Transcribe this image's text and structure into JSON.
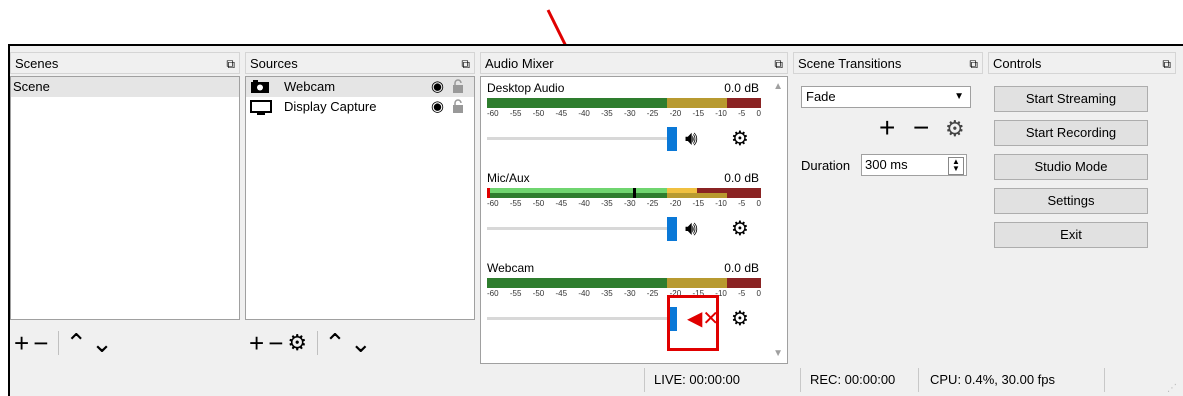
{
  "docks": {
    "scenes": {
      "title": "Scenes",
      "items": [
        "Scene"
      ]
    },
    "sources": {
      "title": "Sources",
      "items": [
        {
          "label": "Webcam",
          "icon": "camera-icon"
        },
        {
          "label": "Display Capture",
          "icon": "monitor-icon"
        }
      ]
    },
    "mixer": {
      "title": "Audio Mixer",
      "channels": [
        {
          "name": "Desktop Audio",
          "db": "0.0 dB",
          "muted": false
        },
        {
          "name": "Mic/Aux",
          "db": "0.0 dB",
          "muted": false
        },
        {
          "name": "Webcam",
          "db": "0.0 dB",
          "muted": true
        }
      ],
      "ticks": [
        "-60",
        "-55",
        "-50",
        "-45",
        "-40",
        "-35",
        "-30",
        "-25",
        "-20",
        "-15",
        "-10",
        "-5",
        "0"
      ]
    },
    "transitions": {
      "title": "Scene Transitions",
      "selected": "Fade",
      "duration_label": "Duration",
      "duration_value": "300 ms"
    },
    "controls": {
      "title": "Controls",
      "buttons": [
        "Start Streaming",
        "Start Recording",
        "Studio Mode",
        "Settings",
        "Exit"
      ]
    }
  },
  "status": {
    "live": "LIVE: 00:00:00",
    "rec": "REC: 00:00:00",
    "cpu": "CPU: 0.4%, 30.00 fps"
  },
  "colors": {
    "annotation": "#e00000",
    "slider": "#0a78d7",
    "meter_green": "#38a238",
    "meter_yellow": "#c8a020",
    "meter_red": "#a02020"
  }
}
